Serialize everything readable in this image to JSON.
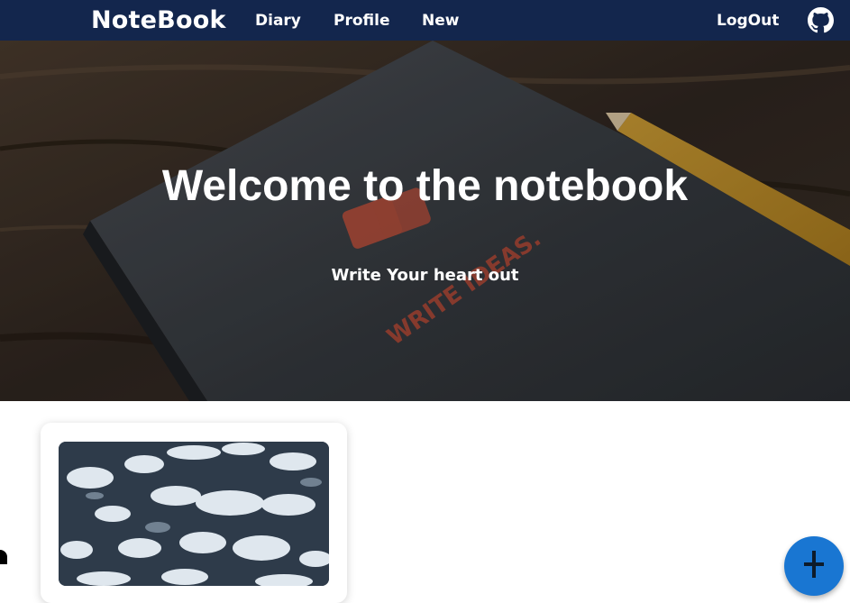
{
  "navbar": {
    "brand": "NoteBook",
    "links": [
      {
        "label": "Diary"
      },
      {
        "label": "Profile"
      },
      {
        "label": "New"
      }
    ],
    "logout_label": "LogOut",
    "github_icon": "github-icon"
  },
  "hero": {
    "title": "Welcome to the notebook",
    "subtitle": "Write Your heart out",
    "notebook_cover_text": "WRITE IDEAS."
  },
  "card": {
    "image_icon": "ice-texture-image"
  },
  "fab": {
    "icon": "plus-icon",
    "color": "#1976d2"
  },
  "colors": {
    "navbar_bg": "#13264d",
    "fab_bg": "#1976d2"
  }
}
